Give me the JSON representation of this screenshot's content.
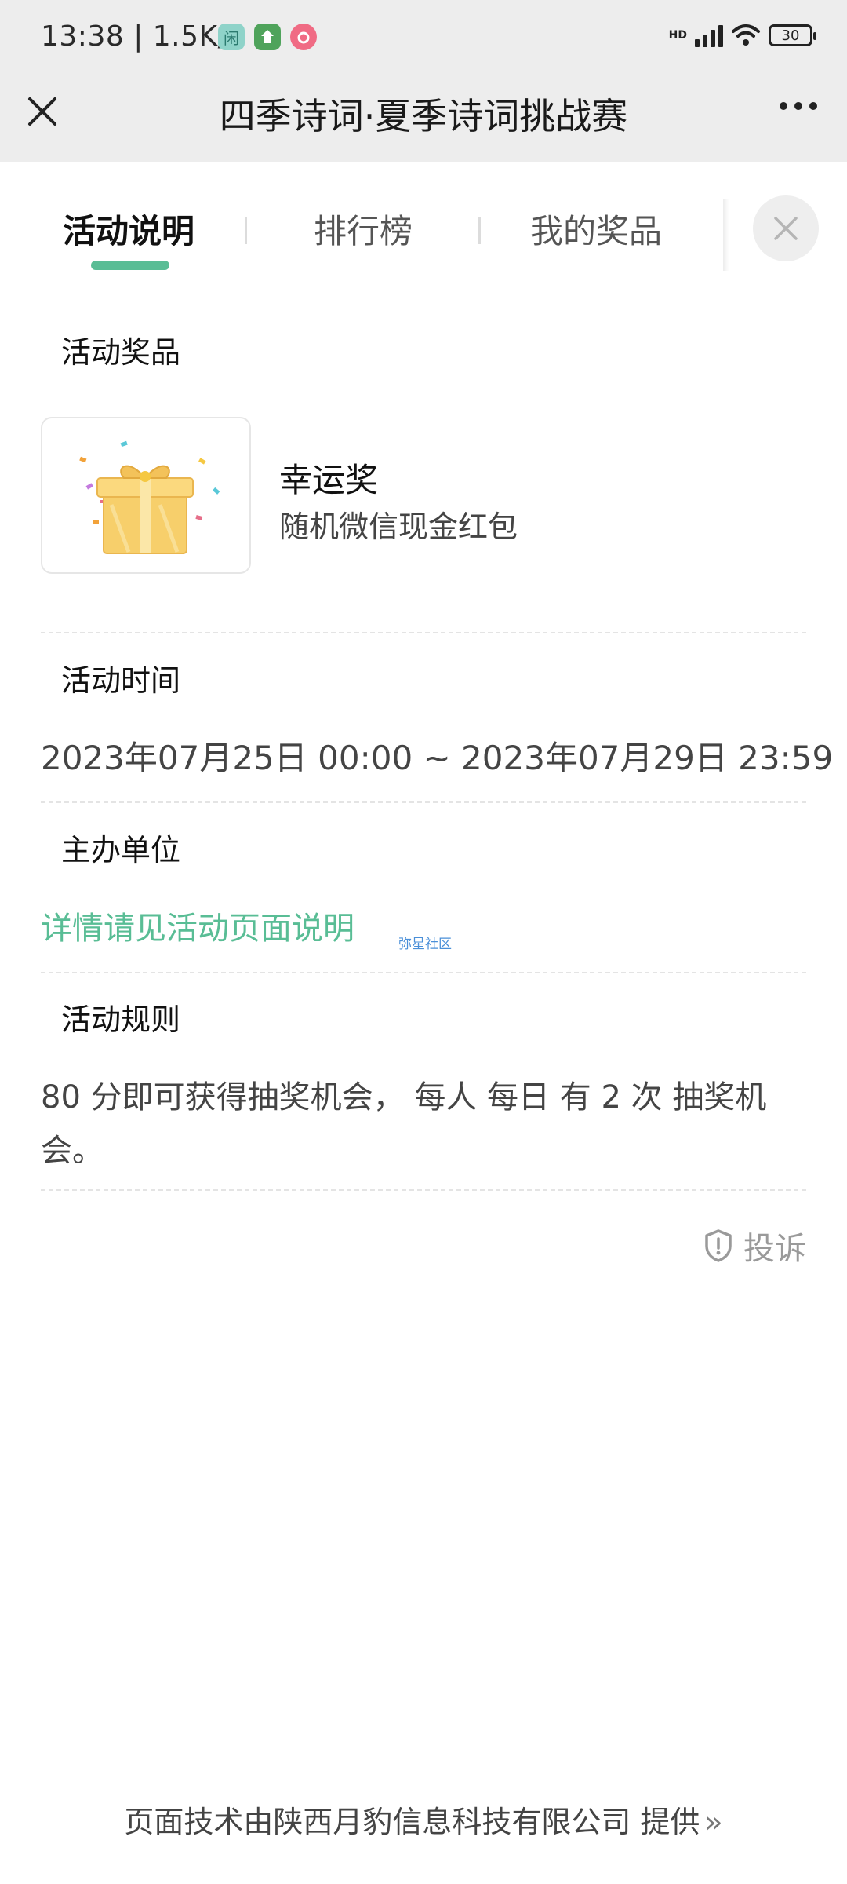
{
  "status_bar": {
    "time": "13:38 | 1.5K/s",
    "app_icons": [
      "闲",
      "",
      ""
    ],
    "battery": "30",
    "network_label": "HD"
  },
  "title_bar": {
    "title": "四季诗词·夏季诗词挑战赛"
  },
  "tabs": {
    "items": [
      {
        "label": "活动说明",
        "active": true
      },
      {
        "label": "排行榜",
        "active": false
      },
      {
        "label": "我的奖品",
        "active": false
      }
    ]
  },
  "sections": {
    "prize": {
      "title": "活动奖品",
      "name": "幸运奖",
      "desc": "随机微信现金红包"
    },
    "time": {
      "title": "活动时间",
      "value": "2023年07月25日 00:00 ~ 2023年07月29日 23:59"
    },
    "organizer": {
      "title": "主办单位",
      "value": "详情请见活动页面说明",
      "watermark": "弥星社区"
    },
    "rules": {
      "title": "活动规则",
      "value": "80 分即可获得抽奖机会， 每人 每日 有 2 次 抽奖机会。"
    }
  },
  "complain": {
    "label": "投诉"
  },
  "footer": {
    "label": "页面技术由陕西月豹信息科技有限公司 提供"
  },
  "colors": {
    "accent": "#59bd95",
    "top_bar_bg": "#ededed",
    "section_highlight": "#eaf7f1"
  }
}
